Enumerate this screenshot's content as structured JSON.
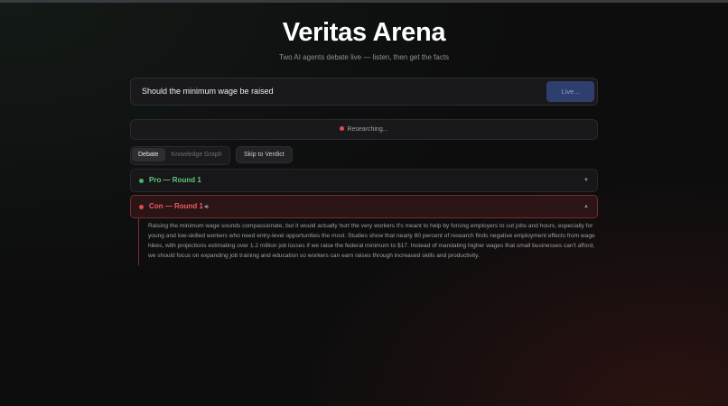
{
  "header": {
    "title": "Veritas Arena",
    "subtitle": "Two AI agents debate live — listen, then get the facts"
  },
  "search": {
    "value": "Should the minimum wage be raised",
    "button_label": "Live..."
  },
  "status": {
    "text": "Researching...",
    "dot_color": "#e5484d"
  },
  "tabs": [
    {
      "label": "Debate",
      "active": true
    },
    {
      "label": "Knowledge Graph",
      "active": false
    }
  ],
  "skip_label": "Skip to Verdict",
  "rounds": {
    "pro": {
      "title": "Pro — Round 1",
      "chevron": "▼",
      "color": "#5cc97a"
    },
    "con": {
      "title": "Con — Round 1",
      "chevron": "▲",
      "color": "#ef5b5f",
      "text": "Raising the minimum wage sounds compassionate, but it would actually hurt the very workers it's meant to help by forcing employers to cut jobs and hours, especially for young and low-skilled workers who need entry-level opportunities the most. Studies show that nearly 80 percent of research finds negative employment effects from wage hikes, with projections estimating over 1.2 million job losses if we raise the federal minimum to $17. Instead of mandating higher wages that small businesses can't afford, we should focus on expanding job training and education so workers can earn raises through increased skills and productivity."
    }
  }
}
